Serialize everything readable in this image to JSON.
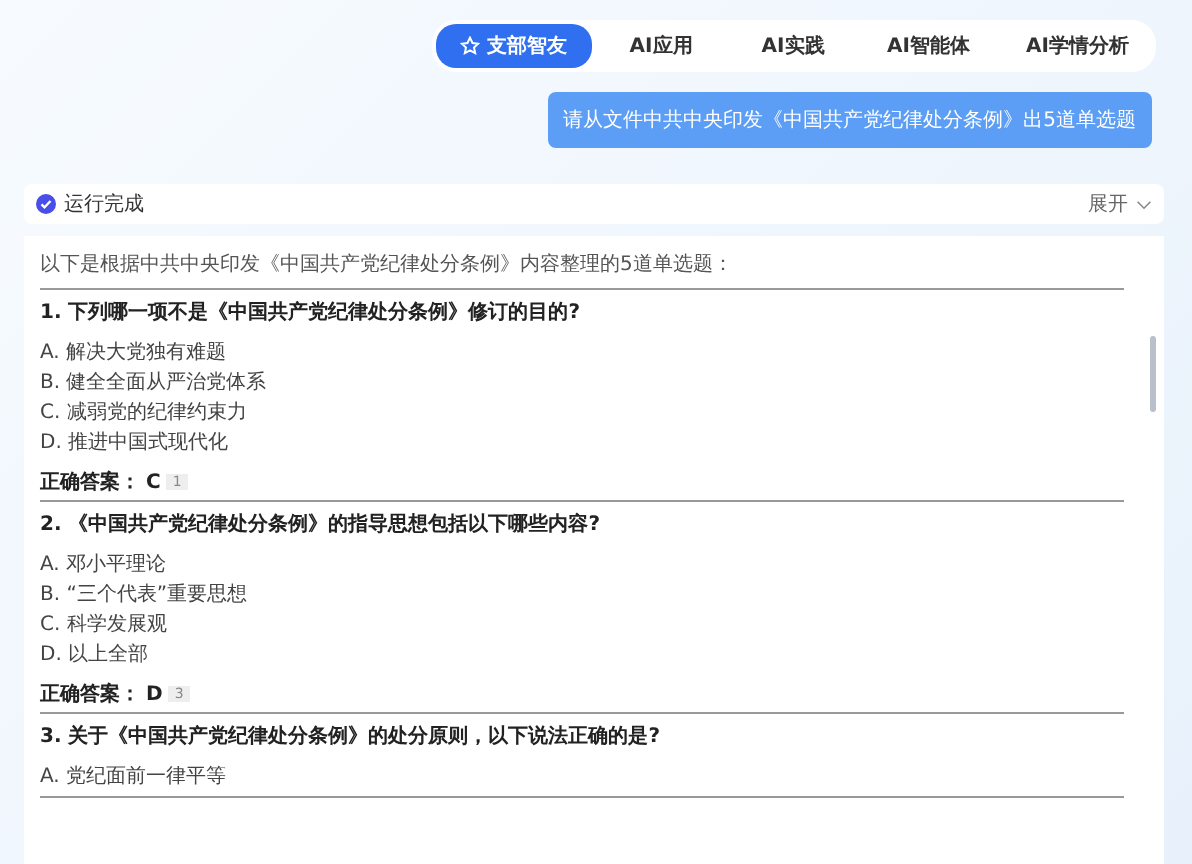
{
  "tabs": [
    {
      "label": "支部智友",
      "selected": true
    },
    {
      "label": "AI应用",
      "selected": false
    },
    {
      "label": "AI实践",
      "selected": false
    },
    {
      "label": "AI智能体",
      "selected": false
    },
    {
      "label": "AI学情分析",
      "selected": false
    }
  ],
  "user_message": "请从文件中共中央印发《中国共产党纪律处分条例》出5道单选题",
  "status": {
    "label": "运行完成",
    "toggle": "展开"
  },
  "answer": {
    "intro": "以下是根据中共中央印发《中国共产党纪律处分条例》内容整理的5道单选题：",
    "questions": [
      {
        "title": "1. 下列哪一项不是《中国共产党纪律处分条例》修订的目的?",
        "options": [
          "A. 解决大党独有难题",
          "B. 健全全面从严治党体系",
          "C. 减弱党的纪律约束力",
          "D. 推进中国式现代化"
        ],
        "answer_label": "正确答案：",
        "answer": "C",
        "ref": "1"
      },
      {
        "title": "2. 《中国共产党纪律处分条例》的指导思想包括以下哪些内容?",
        "options": [
          "A. 邓小平理论",
          "B. “三个代表”重要思想",
          "C. 科学发展观",
          "D. 以上全部"
        ],
        "answer_label": "正确答案：",
        "answer": "D",
        "ref": "3"
      },
      {
        "title": "3. 关于《中国共产党纪律处分条例》的处分原则，以下说法正确的是?",
        "options": [
          "A. 党纪面前一律平等"
        ]
      }
    ]
  }
}
